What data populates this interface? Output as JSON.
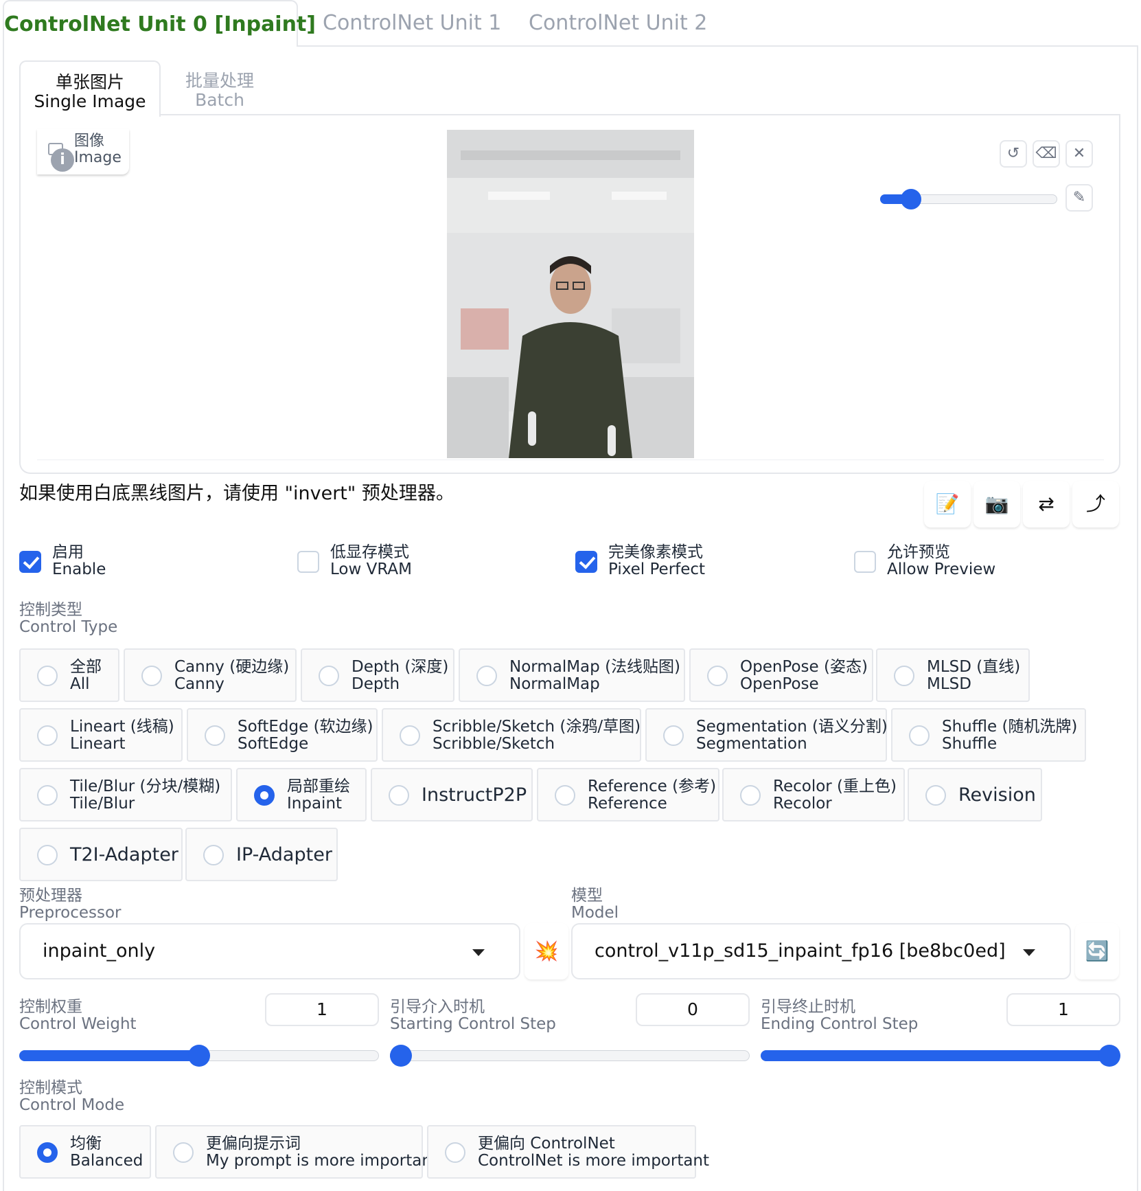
{
  "unit_tabs": [
    {
      "label": "ControlNet Unit 0 [Inpaint]",
      "active": true
    },
    {
      "label": "ControlNet Unit 1",
      "active": false
    },
    {
      "label": "ControlNet Unit 2",
      "active": false
    }
  ],
  "sub_tabs": [
    {
      "zh": "单张图片",
      "en": "Single Image",
      "active": true
    },
    {
      "zh": "批量处理",
      "en": "Batch",
      "active": false
    }
  ],
  "image_label": {
    "zh": "图像",
    "en": "Image",
    "info_glyph": "i"
  },
  "image_tools": {
    "undo_glyph": "↺",
    "eraser_glyph": "⌫",
    "clear_glyph": "✕",
    "brush_glyph": "✎",
    "brush_size": 0.13
  },
  "hint": "如果使用白底黑线图片，请使用 \"invert\" 预处理器。",
  "action_buttons": {
    "edit_glyph": "📝",
    "camera_glyph": "📷",
    "swap_glyph": "⇄",
    "send_glyph": "⤴"
  },
  "checkboxes": [
    {
      "zh": "启用",
      "en": "Enable",
      "checked": true
    },
    {
      "zh": "低显存模式",
      "en": "Low VRAM",
      "checked": false
    },
    {
      "zh": "完美像素模式",
      "en": "Pixel Perfect",
      "checked": true
    },
    {
      "zh": "允许预览",
      "en": "Allow Preview",
      "checked": false
    }
  ],
  "control_type": {
    "label_zh": "控制类型",
    "label_en": "Control Type",
    "options": [
      {
        "zh": "全部",
        "en": "All",
        "selected": false
      },
      {
        "zh": "Canny (硬边缘)",
        "en": "Canny",
        "selected": false
      },
      {
        "zh": "Depth (深度)",
        "en": "Depth",
        "selected": false
      },
      {
        "zh": "NormalMap (法线贴图)",
        "en": "NormalMap",
        "selected": false
      },
      {
        "zh": "OpenPose (姿态)",
        "en": "OpenPose",
        "selected": false
      },
      {
        "zh": "MLSD (直线)",
        "en": "MLSD",
        "selected": false
      },
      {
        "zh": "Lineart (线稿)",
        "en": "Lineart",
        "selected": false
      },
      {
        "zh": "SoftEdge (软边缘)",
        "en": "SoftEdge",
        "selected": false
      },
      {
        "zh": "Scribble/Sketch (涂鸦/草图)",
        "en": "Scribble/Sketch",
        "selected": false
      },
      {
        "zh": "Segmentation (语义分割)",
        "en": "Segmentation",
        "selected": false
      },
      {
        "zh": "Shuffle (随机洗牌)",
        "en": "Shuffle",
        "selected": false
      },
      {
        "zh": "Tile/Blur (分块/模糊)",
        "en": "Tile/Blur",
        "selected": false
      },
      {
        "zh": "局部重绘",
        "en": "Inpaint",
        "selected": true
      },
      {
        "zh": "InstructP2P",
        "en": "",
        "selected": false
      },
      {
        "zh": "Reference (参考)",
        "en": "Reference",
        "selected": false
      },
      {
        "zh": "Recolor (重上色)",
        "en": "Recolor",
        "selected": false
      },
      {
        "zh": "Revision",
        "en": "",
        "selected": false
      },
      {
        "zh": "T2I-Adapter",
        "en": "",
        "selected": false
      },
      {
        "zh": "IP-Adapter",
        "en": "",
        "selected": false
      }
    ]
  },
  "preprocessor": {
    "label_zh": "预处理器",
    "label_en": "Preprocessor",
    "value": "inpaint_only",
    "run_glyph": "💥"
  },
  "model": {
    "label_zh": "模型",
    "label_en": "Model",
    "value": "control_v11p_sd15_inpaint_fp16 [be8bc0ed]",
    "refresh_glyph": "🔄"
  },
  "sliders": [
    {
      "label_zh": "控制权重",
      "label_en": "Control Weight",
      "value": "1",
      "fraction": 0.5
    },
    {
      "label_zh": "引导介入时机",
      "label_en": "Starting Control Step",
      "value": "0",
      "fraction": 0.0
    },
    {
      "label_zh": "引导终止时机",
      "label_en": "Ending Control Step",
      "value": "1",
      "fraction": 1.0
    }
  ],
  "control_mode": {
    "label_zh": "控制模式",
    "label_en": "Control Mode",
    "options": [
      {
        "zh": "均衡",
        "en": "Balanced",
        "selected": true
      },
      {
        "zh": "更偏向提示词",
        "en": "My prompt is more important",
        "selected": false
      },
      {
        "zh": "更偏向 ControlNet",
        "en": "ControlNet is more important",
        "selected": false
      }
    ]
  },
  "colors": {
    "accent": "#2563eb",
    "active_tab": "#2f7a1f",
    "border": "#e5e7eb"
  }
}
